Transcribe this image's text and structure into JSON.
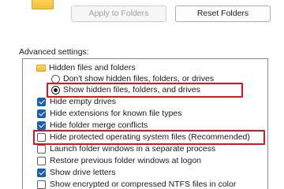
{
  "toolbar": {
    "apply_label": "Apply to Folders",
    "reset_label": "Reset Folders"
  },
  "advanced": {
    "label": "Advanced settings:",
    "items": [
      {
        "kind": "folder",
        "label": "Hidden files and folders"
      },
      {
        "kind": "radio",
        "checked": false,
        "label": "Don't show hidden files, folders, or drives"
      },
      {
        "kind": "radio",
        "checked": true,
        "label": "Show hidden files, folders, and drives"
      },
      {
        "kind": "checkbox",
        "checked": true,
        "label": "Hide empty drives"
      },
      {
        "kind": "checkbox",
        "checked": true,
        "label": "Hide extensions for known file types"
      },
      {
        "kind": "checkbox",
        "checked": true,
        "label": "Hide folder merge conflicts"
      },
      {
        "kind": "checkbox",
        "checked": false,
        "label": "Hide protected operating system files (Recommended)"
      },
      {
        "kind": "checkbox",
        "checked": false,
        "label": "Launch folder windows in a separate process"
      },
      {
        "kind": "checkbox",
        "checked": false,
        "label": "Restore previous folder windows at logon"
      },
      {
        "kind": "checkbox",
        "checked": true,
        "label": "Show drive letters"
      },
      {
        "kind": "checkbox",
        "checked": false,
        "label": "Show encrypted or compressed NTFS files in color"
      }
    ]
  },
  "colors": {
    "highlight": "#d6171f",
    "checkbox_accent": "#1a5fb4"
  }
}
